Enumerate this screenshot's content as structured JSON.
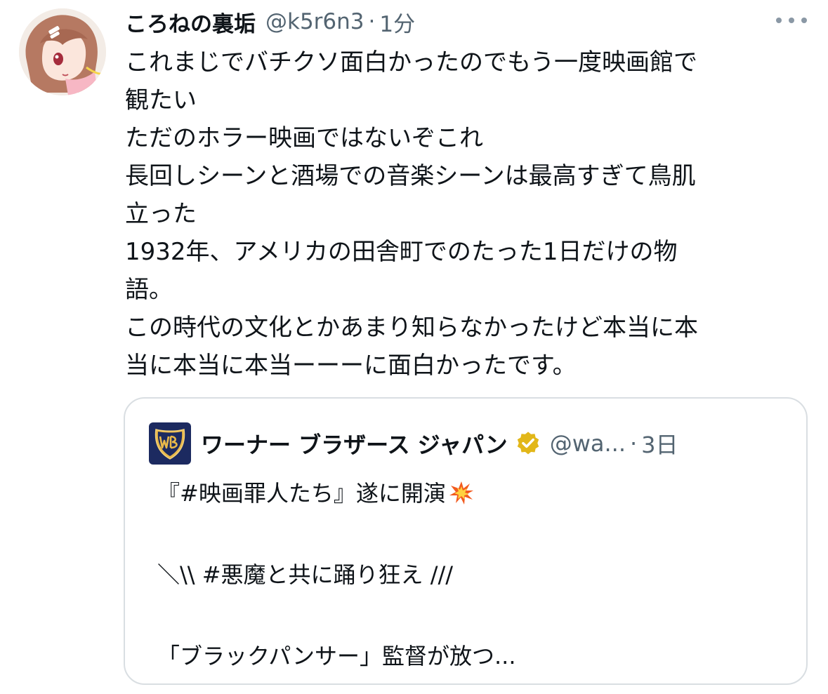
{
  "author": {
    "display_name": "ころねの裏垢",
    "handle": "@k5r6n3",
    "separator": "·",
    "time": "1分",
    "avatar_icon": "anime-girl-avatar-icon"
  },
  "tweet": {
    "lines": [
      "これまじでバチクソ面白かったのでもう一度映画館で",
      "観たい",
      "ただのホラー映画ではないぞこれ",
      "長回しシーンと酒場での音楽シーンは最高すぎて鳥肌",
      "立った",
      "1932年、アメリカの田舎町でのたった1日だけの物",
      "語。",
      "この時代の文化とかあまり知らなかったけど本当に本",
      "当に本当に本当ーーーに面白かったです。"
    ]
  },
  "quoted": {
    "display_name": "ワーナー ブラザース ジャパン",
    "handle": "@wa...",
    "separator": "·",
    "time": "3日",
    "logo_icon": "wb-shield-logo-icon",
    "verified_icon": "verified-badge-icon",
    "line1": "『#映画罪人たち』遂に開演",
    "line1_emoji": "collision-emoji-icon",
    "line2": "＼\\\\ #悪魔と共に踊り狂え ///",
    "line3": "「ブラックパンサー」監督が放つ..."
  },
  "colors": {
    "text_primary": "#0f1419",
    "text_secondary": "#536471",
    "border": "#d9dee2",
    "verified_gold": "#e2b719",
    "wb_navy": "#1c2a60"
  }
}
